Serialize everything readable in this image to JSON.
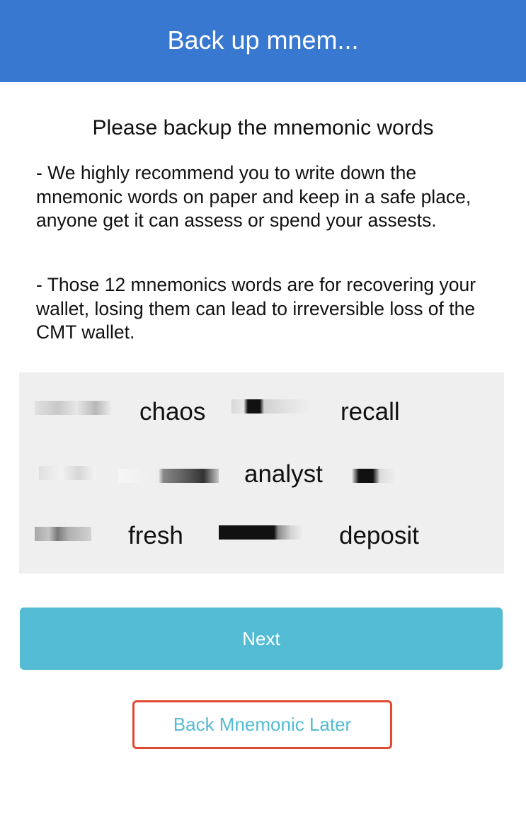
{
  "nav": {
    "title": "Back up mnem..."
  },
  "content": {
    "heading": "Please backup the mnemonic words",
    "paragraph_1": "- We highly recommend you to write down the mnemonic words on paper and keep in a safe place, anyone get it can assess or spend your assests.",
    "paragraph_2": "- Those 12 mnemonics words are for recovering your wallet, losing them can lead to irreversible loss of the CMT wallet."
  },
  "mnemonic": {
    "visible_words": [
      "chaos",
      "recall",
      "analyst",
      "fresh",
      "deposit"
    ]
  },
  "actions": {
    "next_label": "Next",
    "later_label": "Back Mnemonic Later"
  },
  "colors": {
    "nav_background": "#3878d0",
    "next_button": "#53bbd3",
    "later_text": "#53bbd3",
    "highlight_border": "#e04a30",
    "word_panel": "#efefef"
  }
}
